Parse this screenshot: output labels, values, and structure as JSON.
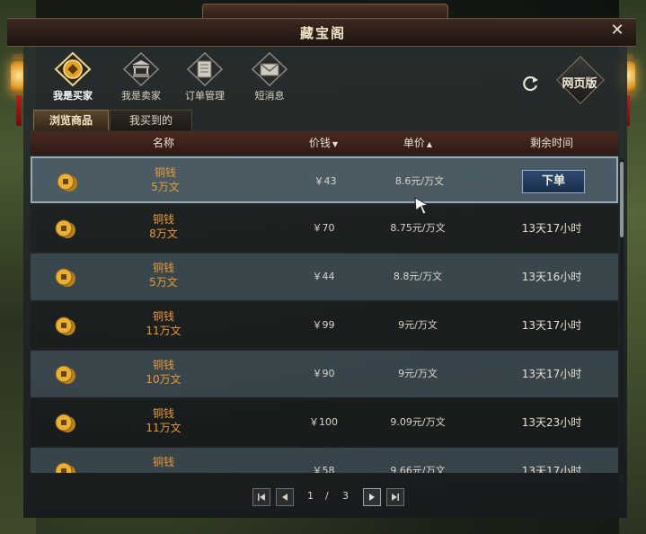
{
  "window": {
    "title": "藏宝阁",
    "close_symbol": "✕"
  },
  "nav": {
    "items": [
      {
        "label": "我是买家",
        "icon": "coin-diamond-icon",
        "active": true
      },
      {
        "label": "我是卖家",
        "icon": "market-stall-icon",
        "active": false
      },
      {
        "label": "订单管理",
        "icon": "ledger-book-icon",
        "active": false
      },
      {
        "label": "短消息",
        "icon": "envelope-icon",
        "active": false
      }
    ],
    "refresh_icon": "refresh-icon",
    "web_button_label": "网页版"
  },
  "subtabs": {
    "browse": "浏览商品",
    "bought": "我买到的"
  },
  "table": {
    "headers": {
      "name": "名称",
      "price": "价钱",
      "unit_price": "单价",
      "time_left": "剩余时间"
    },
    "order_button_label": "下单",
    "rows": [
      {
        "name": "铜钱",
        "amount": "5万文",
        "price": "￥43",
        "unit": "8.6元/万文",
        "time": ""
      },
      {
        "name": "铜钱",
        "amount": "8万文",
        "price": "￥70",
        "unit": "8.75元/万文",
        "time": "13天17小时"
      },
      {
        "name": "铜钱",
        "amount": "5万文",
        "price": "￥44",
        "unit": "8.8元/万文",
        "time": "13天16小时"
      },
      {
        "name": "铜钱",
        "amount": "11万文",
        "price": "￥99",
        "unit": "9元/万文",
        "time": "13天17小时"
      },
      {
        "name": "铜钱",
        "amount": "10万文",
        "price": "￥90",
        "unit": "9元/万文",
        "time": "13天17小时"
      },
      {
        "name": "铜钱",
        "amount": "11万文",
        "price": "￥100",
        "unit": "9.09元/万文",
        "time": "13天23小时"
      },
      {
        "name": "铜钱",
        "amount": "",
        "price": "￥58",
        "unit": "9.66元/万文",
        "time": "13天17小时"
      }
    ]
  },
  "pagination": {
    "current": "1",
    "separator": "/",
    "total": "3"
  },
  "colors": {
    "name_text": "#e89a38",
    "row_alt": "#4e626e",
    "header_bg": "#4a2a20",
    "order_button": "#2e4a6e"
  }
}
